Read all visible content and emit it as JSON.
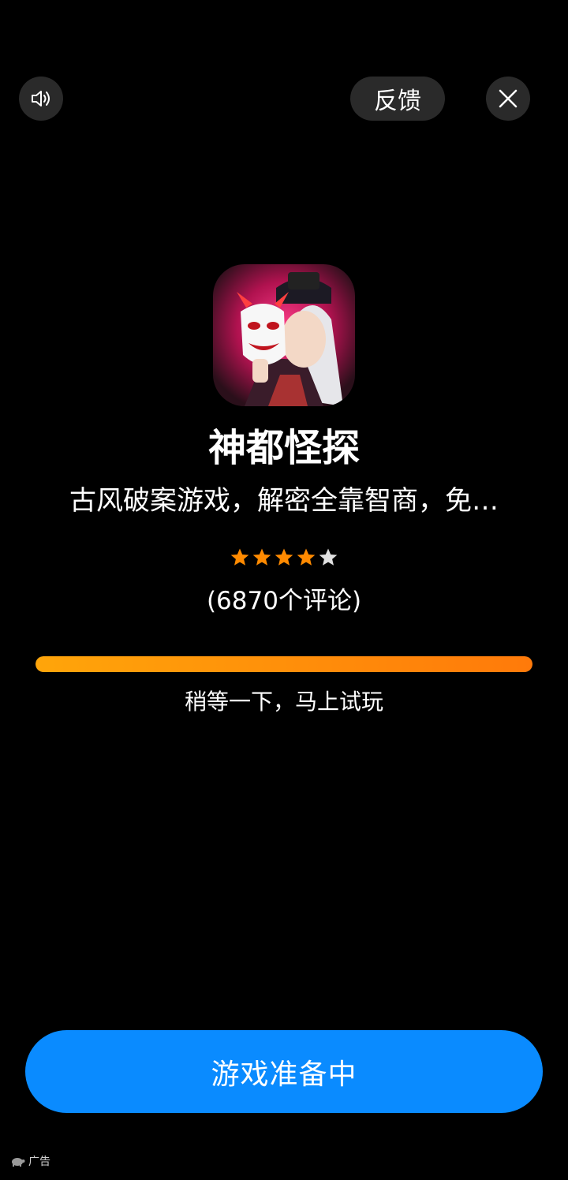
{
  "header": {
    "sound_icon": "speaker-icon",
    "feedback_label": "反馈",
    "close_icon": "close-icon"
  },
  "app": {
    "title": "神都怪探",
    "description": "古风破案游戏，解密全靠智商，免…",
    "rating": 4,
    "rating_max": 5,
    "review_count_text": "(6870个评论)"
  },
  "progress": {
    "value": 1.0,
    "text": "稍等一下，马上试玩"
  },
  "main_button": {
    "label": "游戏准备中"
  },
  "ad": {
    "label": "广告",
    "icon": "turtle-icon"
  },
  "colors": {
    "background": "#000000",
    "accent_blue": "#0a8bff",
    "progress_orange": "#ff8c0a",
    "star_filled": "#ff8a00",
    "star_empty": "#e0e0e0"
  }
}
